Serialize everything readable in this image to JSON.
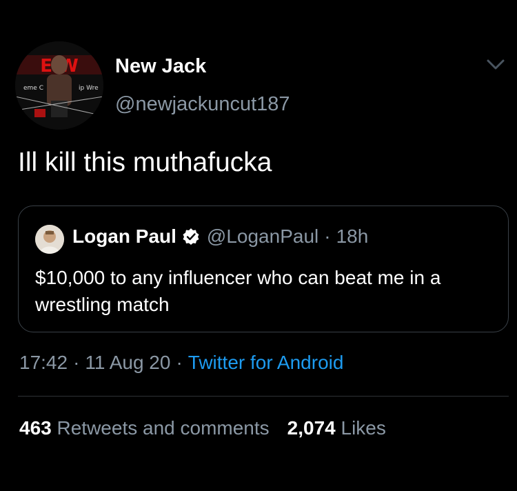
{
  "tweet": {
    "display_name": "New Jack",
    "handle": "@newjackuncut187",
    "text": "Ill kill this muthafucka",
    "avatar_icon": "wrestler-avatar",
    "caret_icon": "chevron-down-icon"
  },
  "quoted": {
    "display_name": "Logan Paul",
    "handle": "@LoganPaul",
    "separator": "·",
    "time": "18h",
    "text": "$10,000 to any influencer who can beat me in a wrestling match",
    "verified_icon": "verified-badge-icon"
  },
  "meta": {
    "time": "17:42",
    "date": "11 Aug 20",
    "separator": "·",
    "source": "Twitter for Android"
  },
  "stats": {
    "retweets_count": "463",
    "retweets_label": "Retweets and comments",
    "likes_count": "2,074",
    "likes_label": "Likes"
  },
  "colors": {
    "background": "#000000",
    "text": "#ffffff",
    "muted": "#8b98a5",
    "link": "#1d9bf0",
    "border": "#3a4148"
  }
}
